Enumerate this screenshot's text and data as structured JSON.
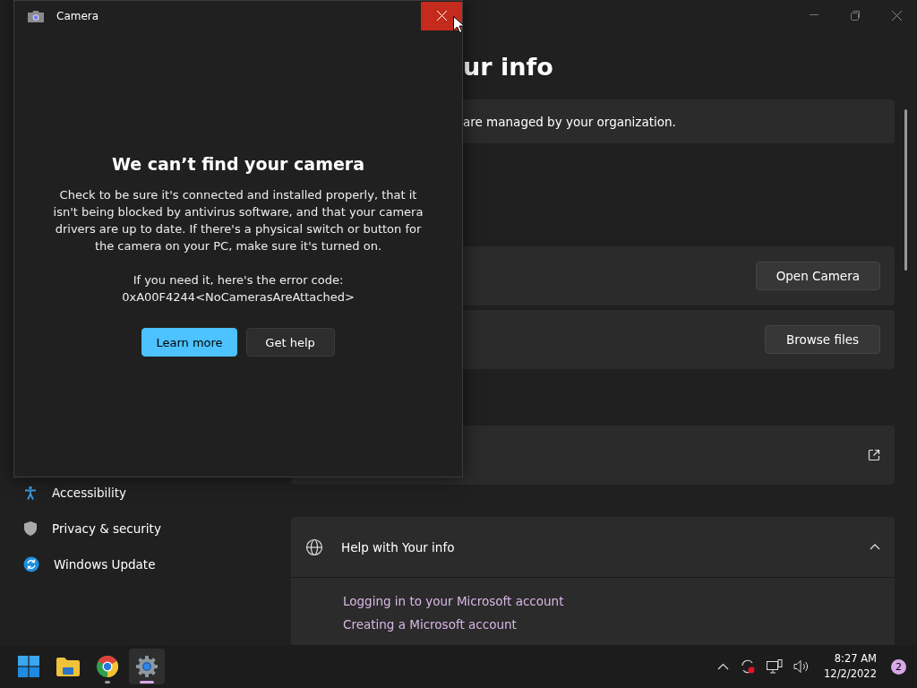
{
  "settings_window": {
    "heading": "ur info",
    "notice": "are managed by your organization.",
    "sidebar": [
      {
        "label": "Accessibility",
        "kind": "accessibility"
      },
      {
        "label": "Privacy & security",
        "kind": "shield"
      },
      {
        "label": "Windows Update",
        "kind": "update"
      }
    ],
    "cards": [
      {
        "kind": "button",
        "button": "Open Camera"
      },
      {
        "kind": "button",
        "button": "Browse files"
      },
      {
        "kind": "link"
      }
    ],
    "help": {
      "title": "Help with Your info",
      "expanded": true,
      "links": [
        "Logging in to your Microsoft account",
        "Creating a Microsoft account"
      ]
    }
  },
  "camera_dialog": {
    "title": "Camera",
    "heading": "We can’t find your camera",
    "message": "Check to be sure it's connected and installed properly, that it isn't being blocked by antivirus software, and that your camera drivers are up to date. If there's a physical switch or button for the camera on your PC, make sure it's turned on.",
    "error_intro": "If you need it, here's the error code:",
    "error_code": "0xA00F4244<NoCamerasAreAttached>",
    "buttons": [
      {
        "label": "Learn more",
        "primary": true
      },
      {
        "label": "Get help",
        "primary": false
      }
    ]
  },
  "taskbar": {
    "apps": [
      {
        "kind": "start",
        "running": false,
        "selected": false
      },
      {
        "kind": "folder",
        "running": false,
        "selected": false
      },
      {
        "kind": "browser",
        "running": true,
        "selected": false
      },
      {
        "kind": "settings",
        "running": true,
        "selected": true
      }
    ],
    "time": "8:27 AM",
    "date": "12/2/2022",
    "notifications": "2"
  }
}
